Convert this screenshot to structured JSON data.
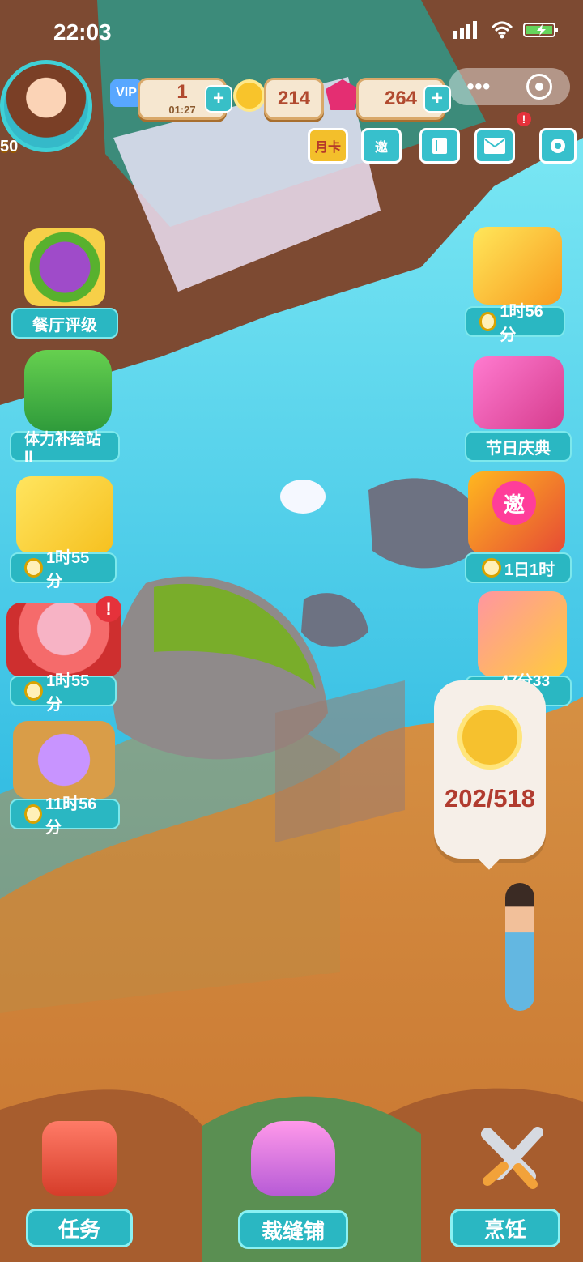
{
  "status_bar": {
    "time": "22:03"
  },
  "top_bar": {
    "vip_label": "VIP",
    "stamina_value": "1",
    "stamina_timer": "01:27",
    "coins_value": "214",
    "gems_value": "264",
    "level": "50",
    "month_card_label": "月卡",
    "invite_label": "邀"
  },
  "left_panel": [
    {
      "label": "餐厅评级"
    },
    {
      "label": "体力补给站II"
    },
    {
      "label": "1时55分"
    },
    {
      "label": "1时55分"
    },
    {
      "label": "11时56分"
    }
  ],
  "right_panel": [
    {
      "label": "1时56分"
    },
    {
      "label": "节日庆典"
    },
    {
      "label": "1日1时",
      "icon_text": "邀"
    },
    {
      "label": "47分33秒"
    }
  ],
  "coin_collector": {
    "progress_text": "202/518"
  },
  "bottom_nav": {
    "tasks_label": "任务",
    "tailor_label": "裁缝铺",
    "cooking_label": "烹饪"
  },
  "colors": {
    "accent_teal": "#2ab7c2",
    "coin_red": "#b13b2f",
    "water": "#39c9e5",
    "ground": "#e9a348"
  }
}
